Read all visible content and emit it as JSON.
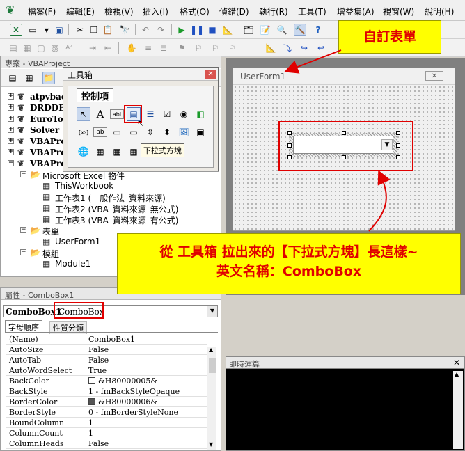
{
  "menu": [
    "檔案(F)",
    "編輯(E)",
    "檢視(V)",
    "插入(I)",
    "格式(O)",
    "偵錯(D)",
    "執行(R)",
    "工具(T)",
    "增益集(A)",
    "視窗(W)",
    "說明(H)"
  ],
  "project": {
    "title": "專案 - VBAProject",
    "items": [
      {
        "label": "atpvbae",
        "level": 0,
        "bold": true,
        "expander": "+"
      },
      {
        "label": "DRDDB",
        "level": 0,
        "bold": true,
        "expander": "+"
      },
      {
        "label": "EuroTo",
        "level": 0,
        "bold": true,
        "expander": "+"
      },
      {
        "label": "Solver",
        "level": 0,
        "bold": true,
        "expander": "+"
      },
      {
        "label": "VBAPro",
        "level": 0,
        "bold": true,
        "expander": "+"
      },
      {
        "label": "VBAPro",
        "level": 0,
        "bold": true,
        "expander": "+"
      },
      {
        "label": "VBAPro",
        "level": 0,
        "bold": true,
        "expander": "−"
      },
      {
        "label": "Microsoft Excel 物件",
        "level": 1,
        "bold": false,
        "expander": "−"
      },
      {
        "label": "ThisWorkbook",
        "level": 2,
        "bold": false,
        "expander": ""
      },
      {
        "label": "工作表1 (一般作法_資料來源)",
        "level": 2,
        "bold": false,
        "expander": ""
      },
      {
        "label": "工作表2 (VBA_資料來源_無公式)",
        "level": 2,
        "bold": false,
        "expander": ""
      },
      {
        "label": "工作表3 (VBA_資料來源_有公式)",
        "level": 2,
        "bold": false,
        "expander": ""
      },
      {
        "label": "表單",
        "level": 1,
        "bold": false,
        "expander": "−"
      },
      {
        "label": "UserForm1",
        "level": 2,
        "bold": false,
        "expander": ""
      },
      {
        "label": "模組",
        "level": 1,
        "bold": false,
        "expander": "−"
      },
      {
        "label": "Module1",
        "level": 2,
        "bold": false,
        "expander": ""
      }
    ]
  },
  "toolbox": {
    "title": "工具箱",
    "tab": "控制項",
    "tooltip": "下拉式方塊"
  },
  "properties": {
    "title": "屬性 - ComboBox1",
    "object_name": "ComboBox1",
    "object_type": "ComboBox",
    "tabs": [
      "字母順序",
      "性質分類"
    ],
    "rows": [
      {
        "name": "(Name)",
        "value": "ComboBox1",
        "swatch": ""
      },
      {
        "name": "AutoSize",
        "value": "False",
        "swatch": ""
      },
      {
        "name": "AutoTab",
        "value": "False",
        "swatch": ""
      },
      {
        "name": "AutoWordSelect",
        "value": "True",
        "swatch": ""
      },
      {
        "name": "BackColor",
        "value": "&H80000005&",
        "swatch": "#ffffff"
      },
      {
        "name": "BackStyle",
        "value": "1 - fmBackStyleOpaque",
        "swatch": ""
      },
      {
        "name": "BorderColor",
        "value": "&H80000006&",
        "swatch": "#555555"
      },
      {
        "name": "BorderStyle",
        "value": "0 - fmBorderStyleNone",
        "swatch": ""
      },
      {
        "name": "BoundColumn",
        "value": "1",
        "swatch": ""
      },
      {
        "name": "ColumnCount",
        "value": "1",
        "swatch": ""
      },
      {
        "name": "ColumnHeads",
        "value": "False",
        "swatch": ""
      }
    ]
  },
  "userform": {
    "title": "UserForm1"
  },
  "immediate": {
    "title": "即時運算"
  },
  "callouts": {
    "form_label": "自訂表單",
    "combo_line1": "從 工具箱 拉出來的【下拉式方塊】長這樣~",
    "combo_line2": "英文名稱：ComboBox"
  },
  "colors": {
    "highlight": "#ffff00",
    "annotation": "#e00000",
    "vba_green": "#1e7a3c"
  }
}
